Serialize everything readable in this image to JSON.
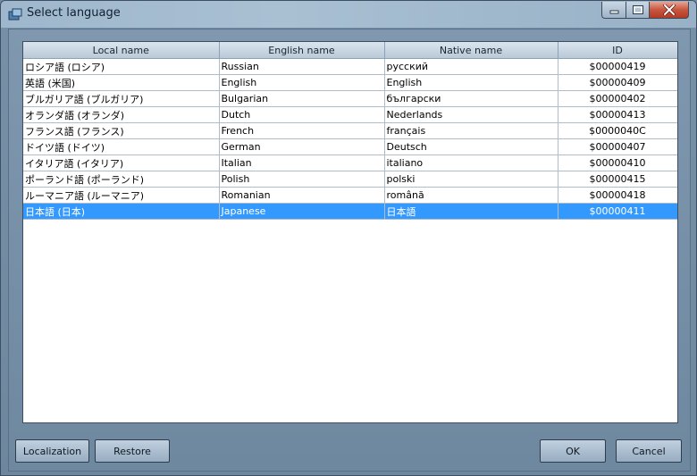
{
  "window": {
    "title": "Select language",
    "controls": {
      "minimize": "minimize",
      "maximize": "maximize",
      "close": "close"
    }
  },
  "table": {
    "columns": [
      "Local name",
      "English name",
      "Native name",
      "ID"
    ],
    "rows": [
      {
        "local": "ロシア語 (ロシア)",
        "english": "Russian",
        "native": "русский",
        "id": "$00000419"
      },
      {
        "local": "英語 (米国)",
        "english": "English",
        "native": "English",
        "id": "$00000409"
      },
      {
        "local": "ブルガリア語 (ブルガリア)",
        "english": "Bulgarian",
        "native": "български",
        "id": "$00000402"
      },
      {
        "local": "オランダ語 (オランダ)",
        "english": "Dutch",
        "native": "Nederlands",
        "id": "$00000413"
      },
      {
        "local": "フランス語 (フランス)",
        "english": "French",
        "native": "français",
        "id": "$0000040C"
      },
      {
        "local": "ドイツ語 (ドイツ)",
        "english": "German",
        "native": "Deutsch",
        "id": "$00000407"
      },
      {
        "local": "イタリア語 (イタリア)",
        "english": "Italian",
        "native": "italiano",
        "id": "$00000410"
      },
      {
        "local": "ポーランド語 (ポーランド)",
        "english": "Polish",
        "native": "polski",
        "id": "$00000415"
      },
      {
        "local": "ルーマニア語 (ルーマニア)",
        "english": "Romanian",
        "native": "română",
        "id": "$00000418"
      },
      {
        "local": "日本語 (日本)",
        "english": "Japanese",
        "native": "日本語",
        "id": "$00000411"
      }
    ],
    "selected_index": 9,
    "selection_color": "#3399ff"
  },
  "buttons": {
    "localization": "Localization",
    "restore": "Restore",
    "ok": "OK",
    "cancel": "Cancel"
  }
}
